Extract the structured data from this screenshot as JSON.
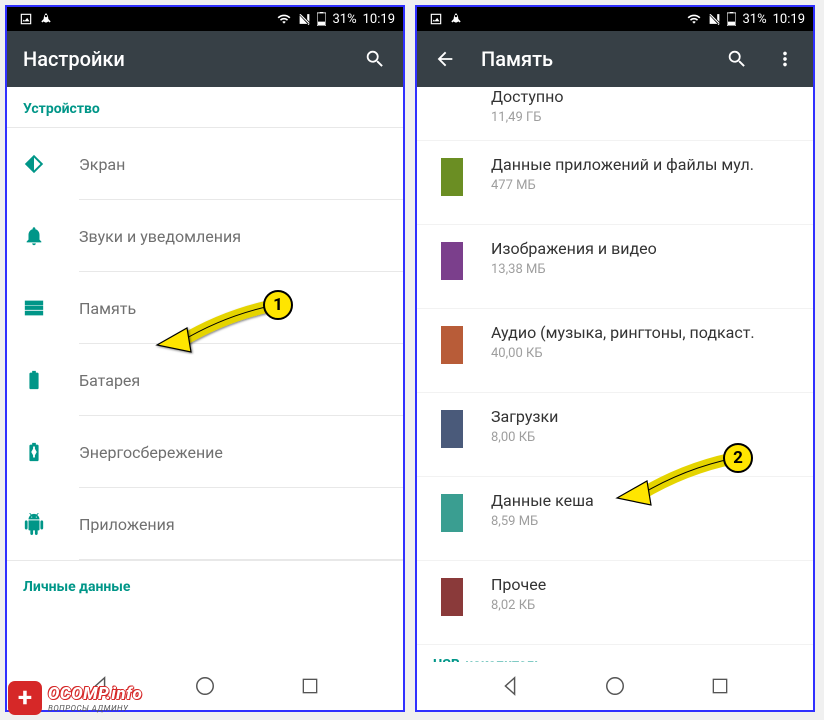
{
  "status": {
    "battery": "31%",
    "time": "10:19"
  },
  "screen1": {
    "title": "Настройки",
    "section1": "Устройство",
    "items": [
      {
        "label": "Экран"
      },
      {
        "label": "Звуки и уведомления"
      },
      {
        "label": "Память"
      },
      {
        "label": "Батарея"
      },
      {
        "label": "Энергосбережение"
      },
      {
        "label": "Приложения"
      }
    ],
    "section2": "Личные данные"
  },
  "screen2": {
    "title": "Память",
    "items": [
      {
        "label": "Доступно",
        "sub": "11,49 ГБ",
        "color": ""
      },
      {
        "label": "Данные приложений и файлы мул.",
        "sub": "477 МБ",
        "color": "#6b8e23"
      },
      {
        "label": "Изображения и видео",
        "sub": "13,38 МБ",
        "color": "#7b3f8c"
      },
      {
        "label": "Аудио (музыка, рингтоны, подкаст.",
        "sub": "40,00 КБ",
        "color": "#b85c38"
      },
      {
        "label": "Загрузки",
        "sub": "8,00 КБ",
        "color": "#4a5a7a"
      },
      {
        "label": "Данные кеша",
        "sub": "8,59 МБ",
        "color": "#3a9e91"
      },
      {
        "label": "Прочее",
        "sub": "8,02 КБ",
        "color": "#8a3a3a"
      }
    ],
    "usb": "USB-накопитель"
  },
  "callouts": {
    "c1": "1",
    "c2": "2"
  },
  "ocomp": {
    "domain": "OCOMP.info",
    "tagline": "ВОПРОСЫ АДМИНУ"
  }
}
